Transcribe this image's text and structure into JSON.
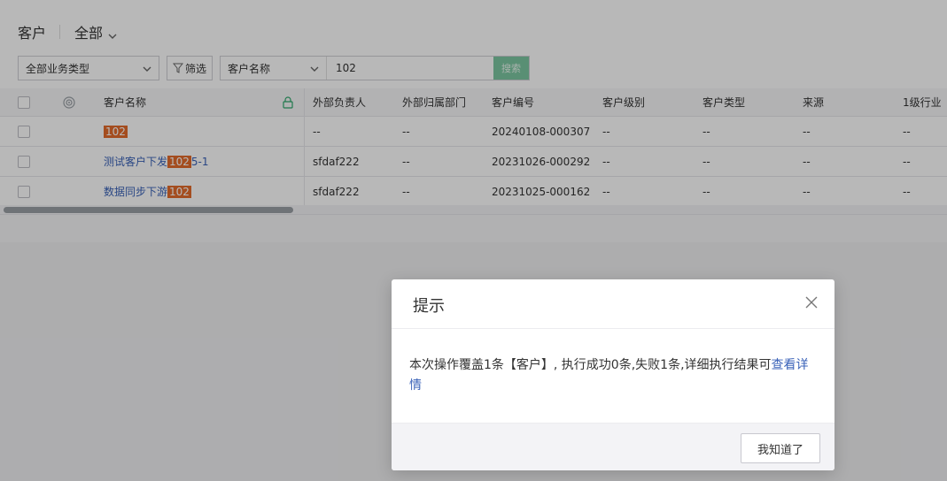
{
  "header": {
    "title": "客户",
    "view": "全部"
  },
  "filters": {
    "biz_type": "全部业务类型",
    "filter_label": "筛选",
    "search_field": "客户名称",
    "search_value": "102",
    "search_button": "搜索"
  },
  "table": {
    "columns": [
      "客户名称",
      "外部负责人",
      "外部归属部门",
      "客户编号",
      "客户级别",
      "客户类型",
      "来源",
      "1级行业"
    ],
    "rows": [
      {
        "name_prefix": "",
        "name_highlight": "102",
        "name_suffix": "",
        "owner": "--",
        "dept": "--",
        "code": "20240108-000307",
        "level": "--",
        "type": "--",
        "source": "--",
        "industry": "--"
      },
      {
        "name_prefix": "测试客户下发",
        "name_highlight": "102",
        "name_suffix": "5-1",
        "owner": "sfdaf222",
        "dept": "--",
        "code": "20231026-000292",
        "level": "--",
        "type": "--",
        "source": "--",
        "industry": "--"
      },
      {
        "name_prefix": "数据同步下游",
        "name_highlight": "102",
        "name_suffix": "",
        "owner": "sfdaf222",
        "dept": "--",
        "code": "20231025-000162",
        "level": "--",
        "type": "--",
        "source": "--",
        "industry": "--"
      }
    ]
  },
  "modal": {
    "title": "提示",
    "message_main": "本次操作覆盖1条【客户】, 执行成功0条,失败1条,详细执行结果可",
    "message_link": "查看详情",
    "ok_label": "我知道了"
  },
  "icons": {
    "chevron": "chevron-down-icon",
    "filter": "filter-icon",
    "target": "target-icon",
    "lock": "lock-icon",
    "close": "close-icon"
  },
  "colors": {
    "highlight": "#e36b2b",
    "link": "#3a62b8",
    "search_button": "#7cc7a1"
  }
}
